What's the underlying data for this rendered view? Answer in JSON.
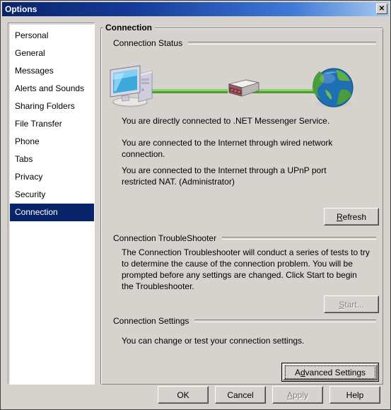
{
  "window": {
    "title": "Options",
    "close_label": "✕",
    "close_icon": "close-icon"
  },
  "sidebar": {
    "items": [
      {
        "label": "Personal",
        "selected": false
      },
      {
        "label": "General",
        "selected": false
      },
      {
        "label": "Messages",
        "selected": false
      },
      {
        "label": "Alerts and Sounds",
        "selected": false
      },
      {
        "label": "Sharing Folders",
        "selected": false
      },
      {
        "label": "File Transfer",
        "selected": false
      },
      {
        "label": "Phone",
        "selected": false
      },
      {
        "label": "Tabs",
        "selected": false
      },
      {
        "label": "Privacy",
        "selected": false
      },
      {
        "label": "Security",
        "selected": false
      },
      {
        "label": "Connection",
        "selected": true
      }
    ]
  },
  "panel": {
    "title": "Connection",
    "sections": {
      "status": {
        "header": "Connection Status",
        "diagram": {
          "computer_icon": "desktop-computer-icon",
          "router_icon": "router-icon",
          "globe_icon": "globe-icon",
          "cable_color": "#6cbf3f"
        },
        "lines": [
          "You are directly connected to .NET Messenger Service.",
          "You are connected to the Internet through wired network connection.",
          "You are connected to the Internet through a UPnP port restricted NAT.  (Administrator)"
        ],
        "refresh_button": {
          "label": "Refresh",
          "accel": "R",
          "enabled": true
        }
      },
      "troubleshooter": {
        "header": "Connection TroubleShooter",
        "text": "The Connection Troubleshooter will conduct a series of tests to try to determine the cause of the connection problem. You will be prompted before any settings are changed. Click Start to begin the Troubleshooter.",
        "start_button": {
          "label": "Start...",
          "accel": "S",
          "enabled": false
        }
      },
      "settings": {
        "header": "Connection Settings",
        "text": "You can change or test your connection settings.",
        "advanced_button": {
          "label": "Advanced Settings",
          "accel": "d",
          "enabled": true,
          "focused": true,
          "is_default": true
        }
      }
    }
  },
  "footer": {
    "buttons": [
      {
        "label": "OK",
        "enabled": true
      },
      {
        "label": "Cancel",
        "enabled": true
      },
      {
        "label": "Apply",
        "enabled": false,
        "accel": "A"
      },
      {
        "label": "Help",
        "enabled": true
      }
    ]
  },
  "colors": {
    "face": "#d6d3ce",
    "title_start": "#0a246a",
    "title_end": "#a6caf0",
    "selection": "#0a246a",
    "cable_green": "#6cbf3f"
  }
}
